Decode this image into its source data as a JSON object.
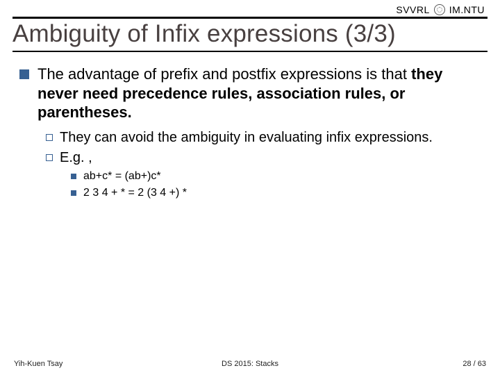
{
  "brand": {
    "left": "SVVRL",
    "at": "@",
    "right": "IM.NTU"
  },
  "title": "Ambiguity of Infix expressions (3/3)",
  "bullets": {
    "l1": "The advantage of prefix and postfix expressions is that they never need precedence rules, association rules, or parentheses.",
    "l2a": "They can avoid the ambiguity in evaluating infix expressions.",
    "l2b": "E.g. ,",
    "l3a": "ab+c* = (ab+)c*",
    "l3b": "2 3 4 + * = 2 (3 4 +) *"
  },
  "footer": {
    "left": "Yih-Kuen Tsay",
    "center": "DS 2015: Stacks",
    "right": "28 / 63"
  }
}
